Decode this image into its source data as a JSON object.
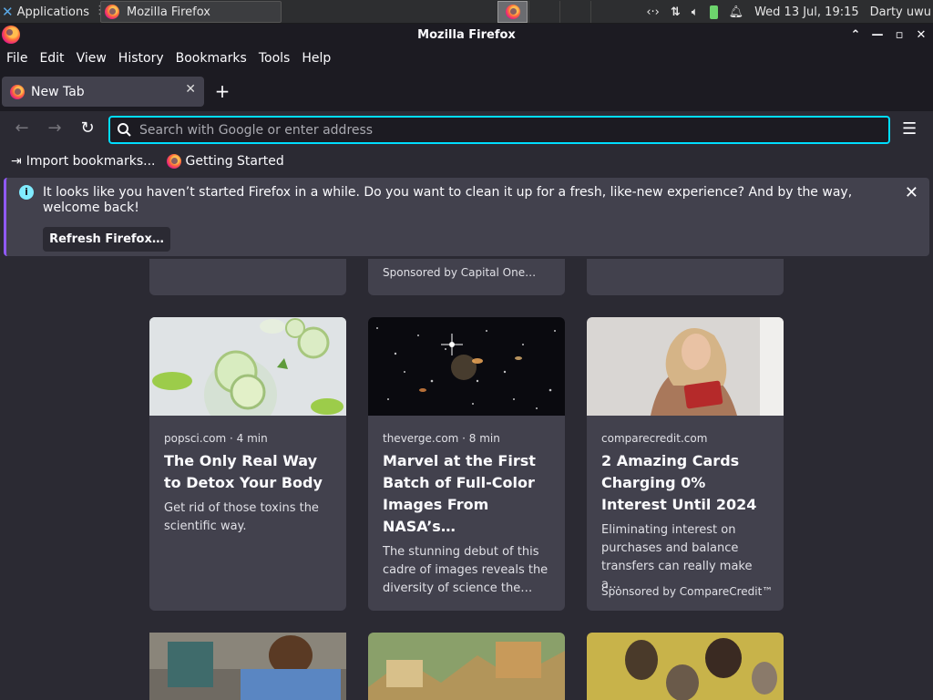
{
  "panel": {
    "applications": "Applications",
    "task_title": "Mozilla Firefox",
    "clock": "Wed 13 Jul, 19:15",
    "user": "Darty uwu",
    "tray_icons": [
      "network-icon",
      "updown-icon",
      "volume-icon",
      "battery-icon",
      "bell-icon"
    ]
  },
  "window": {
    "title": "Mozilla Firefox"
  },
  "menu": [
    "File",
    "Edit",
    "View",
    "History",
    "Bookmarks",
    "Tools",
    "Help"
  ],
  "tab": {
    "label": "New Tab"
  },
  "urlbar": {
    "placeholder": "Search with Google or enter address"
  },
  "bookmarks": {
    "import": "Import bookmarks...",
    "getting_started": "Getting Started"
  },
  "notice": {
    "message": "It looks like you haven’t started Firefox in a while. Do you want to clean it up for a fresh, like-new experience? And by the way, welcome back!",
    "button": "Refresh Firefox…"
  },
  "top_row": {
    "middle_sponsor": "Sponsored by Capital One…"
  },
  "cards": [
    {
      "source": "popsci.com · 4 min",
      "title": "The Only Real Way to Detox Your Body",
      "desc": "Get rid of those toxins the scientific way.",
      "sponsor": ""
    },
    {
      "source": "theverge.com · 8 min",
      "title": "Marvel at the First Batch of Full-Color Images From NASA’s…",
      "desc": "The stunning debut of this cadre of images reveals the diversity of science the…",
      "sponsor": ""
    },
    {
      "source": "comparecredit.com",
      "title": "2 Amazing Cards Charging 0% Interest Until 2024",
      "desc": "Eliminating interest on purchases and balance transfers can really make a…",
      "sponsor": "Sponsored by CompareCredit™"
    }
  ],
  "colors": {
    "accent": "#00ddff",
    "bg": "#2b2a33",
    "card": "#42414d",
    "chrome": "#1c1b22"
  }
}
